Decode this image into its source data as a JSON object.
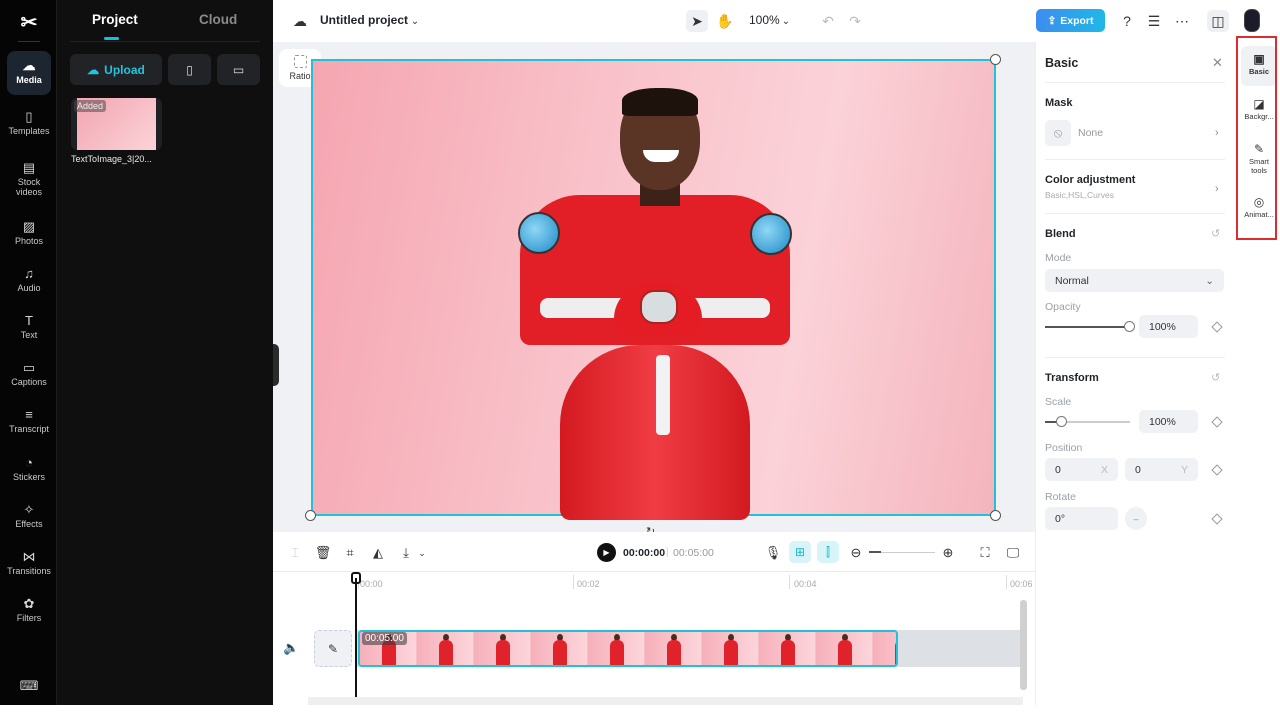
{
  "rail": {
    "items": [
      {
        "label": "Media",
        "icon": "cloud-upload-icon",
        "glyph": "☁"
      },
      {
        "label": "Templates",
        "icon": "templates-icon",
        "glyph": "▯"
      },
      {
        "label": "Stock videos",
        "icon": "film-icon",
        "glyph": "▤"
      },
      {
        "label": "Photos",
        "icon": "image-icon",
        "glyph": "▨"
      },
      {
        "label": "Audio",
        "icon": "music-note-icon",
        "glyph": "♫"
      },
      {
        "label": "Text",
        "icon": "text-icon",
        "glyph": "T"
      },
      {
        "label": "Captions",
        "icon": "captions-icon",
        "glyph": "▭"
      },
      {
        "label": "Transcript",
        "icon": "transcript-icon",
        "glyph": "≡"
      },
      {
        "label": "Stickers",
        "icon": "sticker-icon",
        "glyph": "◔"
      },
      {
        "label": "Effects",
        "icon": "effects-icon",
        "glyph": "✧"
      },
      {
        "label": "Transitions",
        "icon": "transitions-icon",
        "glyph": "⋈"
      },
      {
        "label": "Filters",
        "icon": "filters-icon",
        "glyph": "✿"
      }
    ],
    "keyboard_icon_glyph": "⌨"
  },
  "panel": {
    "tabs": [
      "Project",
      "Cloud"
    ],
    "upload_label": "Upload",
    "media": [
      {
        "badge": "Added",
        "name": "TextToImage_3|20..."
      }
    ]
  },
  "topbar": {
    "project_title": "Untitled project",
    "zoom": "100%",
    "export_label": "Export"
  },
  "canvas": {
    "ratio_label": "Ratio"
  },
  "timeline": {
    "current_time": "00:00:00",
    "total_time": "00:05:00",
    "ticks": [
      "00:00",
      "00:02",
      "00:04",
      "00:06"
    ],
    "clip_duration": "00:05:00",
    "frame_count": 10
  },
  "props": {
    "title": "Basic",
    "mask": {
      "heading": "Mask",
      "value": "None"
    },
    "color_adjustment": {
      "heading": "Color adjustment",
      "sub": "Basic,HSL,Curves"
    },
    "blend": {
      "heading": "Blend",
      "mode_label": "Mode",
      "mode_value": "Normal",
      "opacity_label": "Opacity",
      "opacity_value": "100%",
      "opacity_fraction": 1.0
    },
    "transform": {
      "heading": "Transform",
      "scale_label": "Scale",
      "scale_value": "100%",
      "scale_fraction": 0.2,
      "position_label": "Position",
      "x": "0",
      "x_axis": "X",
      "y": "0",
      "y_axis": "Y",
      "rotate_label": "Rotate",
      "rotate_value": "0°"
    }
  },
  "right_tabs": [
    {
      "label": "Basic",
      "icon": "image-icon",
      "glyph": "▣"
    },
    {
      "label": "Backgr...",
      "icon": "background-icon",
      "glyph": "◪"
    },
    {
      "label": "Smart tools",
      "icon": "magic-wand-icon",
      "glyph": "✎"
    },
    {
      "label": "Animat...",
      "icon": "animation-icon",
      "glyph": "◎"
    }
  ],
  "colors": {
    "accent": "#15c0d6",
    "export_start": "#3c8df0",
    "export_end": "#20b8e6",
    "highlight_box": "#e02b2b"
  }
}
